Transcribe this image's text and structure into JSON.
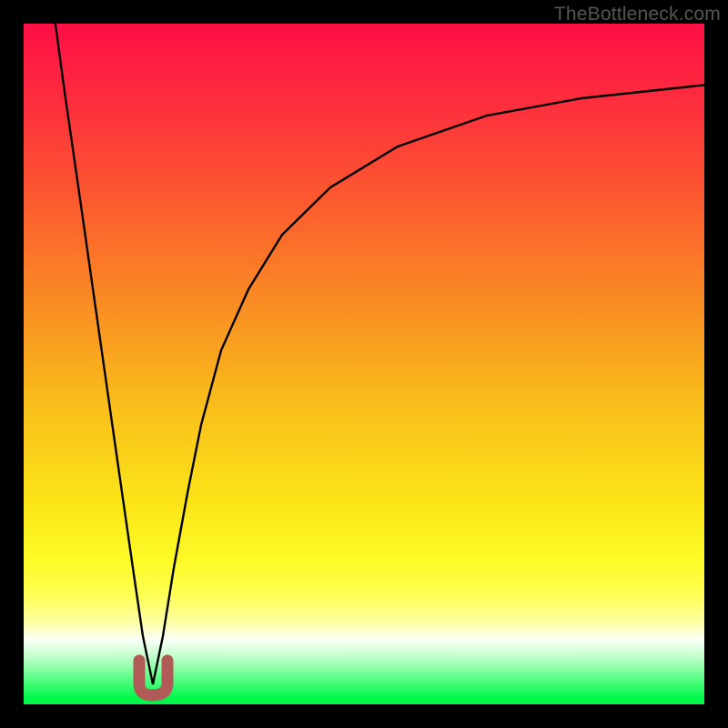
{
  "watermark": "TheBottleneck.com",
  "colors": {
    "frame": "#000000",
    "gradient_stops": [
      {
        "offset": 0.0,
        "color": "#fe0f46"
      },
      {
        "offset": 0.12,
        "color": "#fd2f3d"
      },
      {
        "offset": 0.26,
        "color": "#fb5a2f"
      },
      {
        "offset": 0.4,
        "color": "#f98924"
      },
      {
        "offset": 0.55,
        "color": "#f9bb1b"
      },
      {
        "offset": 0.7,
        "color": "#fbe418"
      },
      {
        "offset": 0.79,
        "color": "#fdfb27"
      },
      {
        "offset": 0.84,
        "color": "#feff55"
      },
      {
        "offset": 0.88,
        "color": "#fdffa6"
      },
      {
        "offset": 0.905,
        "color": "#fafff7"
      },
      {
        "offset": 0.93,
        "color": "#c2ffca"
      },
      {
        "offset": 0.96,
        "color": "#61fd8b"
      },
      {
        "offset": 0.99,
        "color": "#02f94b"
      },
      {
        "offset": 1.0,
        "color": "#02f94b"
      }
    ],
    "curve": "#000000",
    "marker": "#b15a57"
  },
  "chart_data": {
    "type": "line",
    "title": "",
    "xlabel": "",
    "ylabel": "",
    "xlim": [
      0,
      100
    ],
    "ylim": [
      0,
      100
    ],
    "grid": false,
    "legend": false,
    "notes": "Axes are unlabeled in the source image; values are estimated from pixel positions on a 0–100 scale. Curve dips to the green band near x≈19 then rises toward y≈90 at the right edge.",
    "series": [
      {
        "name": "curve",
        "x": [
          4.5,
          6,
          8,
          10,
          12,
          14,
          16,
          17.5,
          19,
          20.5,
          22,
          24,
          26,
          29,
          33,
          38,
          45,
          55,
          68,
          82,
          100
        ],
        "y": [
          100,
          90,
          76,
          62,
          48,
          34,
          20,
          10,
          3,
          10,
          20,
          31,
          41,
          52,
          61,
          69,
          76,
          82,
          86.5,
          89,
          91
        ]
      }
    ],
    "marker_region": {
      "shape": "U",
      "x_center": 19,
      "x_width": 4.5,
      "y_top": 6.5,
      "y_bottom": 1.5
    }
  }
}
